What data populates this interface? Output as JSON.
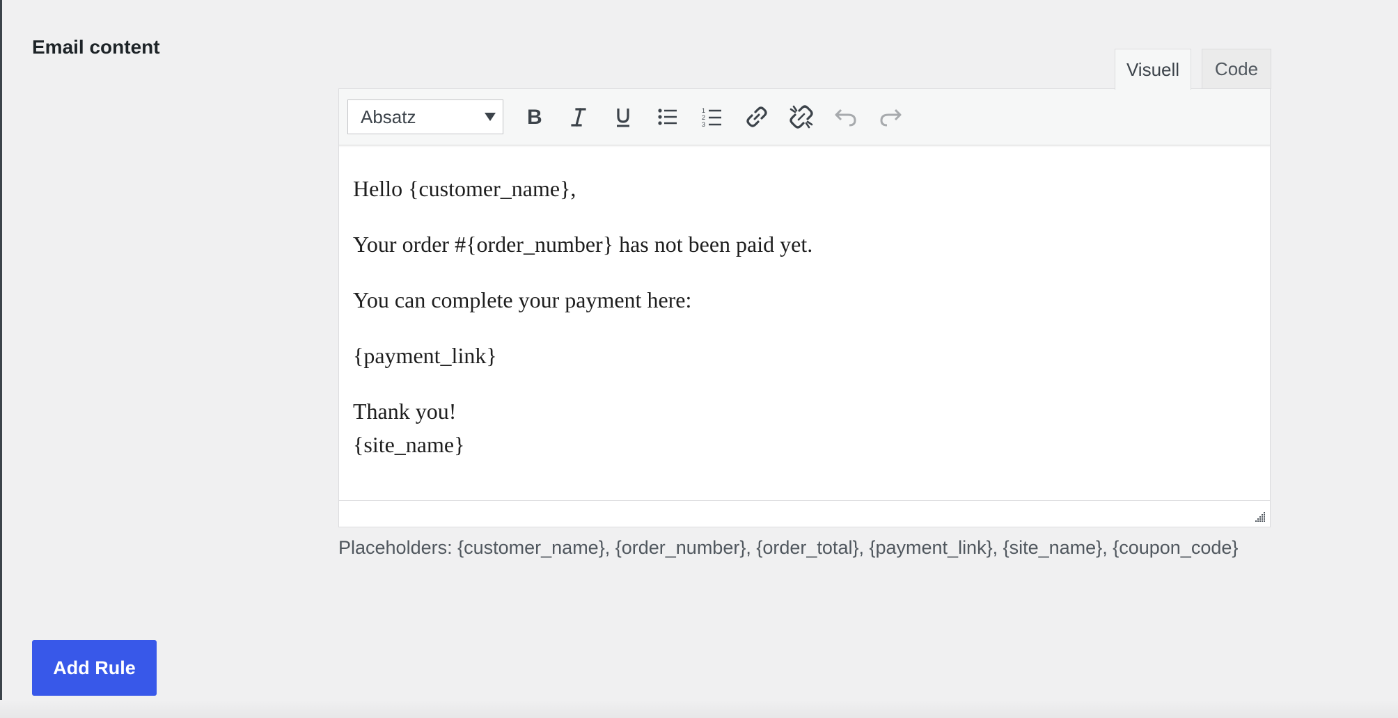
{
  "section": {
    "title": "Email content"
  },
  "editor": {
    "tabs": [
      {
        "label": "Visuell",
        "active": true
      },
      {
        "label": "Code",
        "active": false
      }
    ],
    "toolbar": {
      "format_value": "Absatz",
      "buttons": [
        "bold-icon",
        "italic-icon",
        "underline-icon",
        "bulleted-list-icon",
        "numbered-list-icon",
        "link-icon",
        "unlink-icon",
        "undo-icon",
        "redo-icon"
      ]
    },
    "content": {
      "greeting": "Hello {customer_name},",
      "line1": "Your order #{order_number} has not been paid yet.",
      "line2": "You can complete your payment here:",
      "line3": "{payment_link}",
      "closing": "Thank you!",
      "signature": "{site_name}"
    }
  },
  "placeholders_hint": "Placeholders: {customer_name}, {order_number}, {order_total}, {payment_link}, {site_name}, {coupon_code}",
  "actions": {
    "add_rule_label": "Add Rule"
  },
  "colors": {
    "page_background": "#f0f0f1",
    "primary_button": "#3858e9",
    "toolbar_background": "#f6f7f7",
    "text": "#1d2327",
    "muted_text": "#50575e"
  }
}
